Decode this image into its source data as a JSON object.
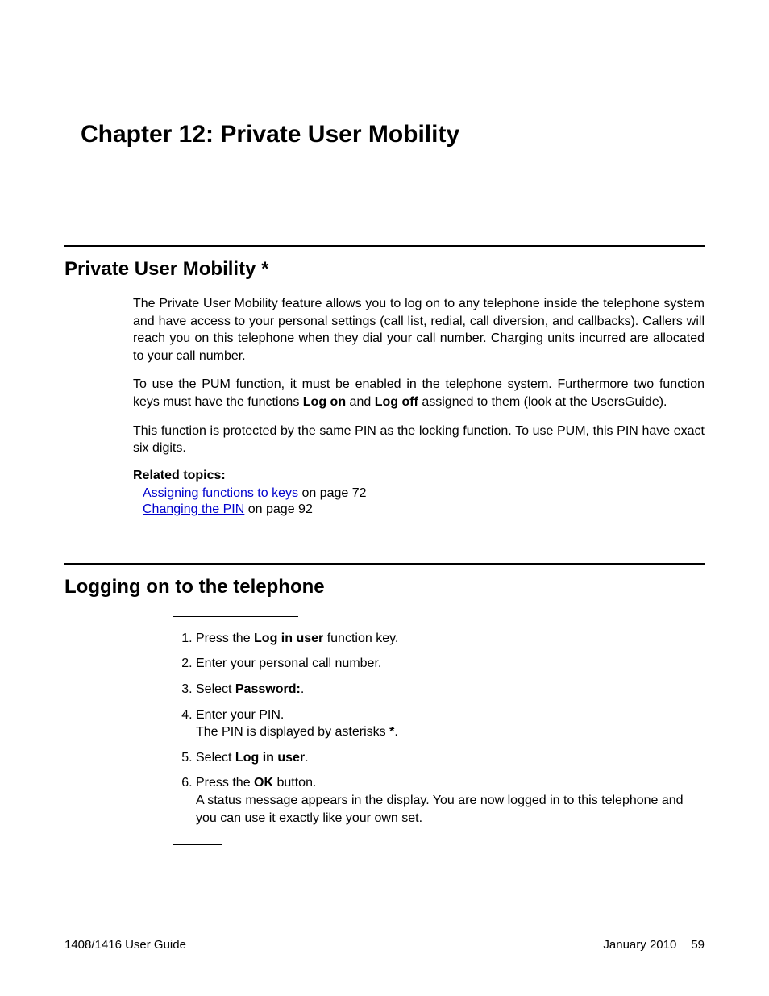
{
  "chapter": {
    "label": "Chapter 12:",
    "title": "Private User Mobility"
  },
  "section1": {
    "heading": "Private User Mobility *",
    "para1": "The Private User Mobility feature allows you to log on to any telephone inside the telephone system and have access to your personal settings (call list, redial, call diversion, and callbacks). Callers will reach you on this telephone when they dial your call number. Charging units incurred are allocated to your call number.",
    "para2a": "To use the PUM function, it must be enabled in the telephone system. Furthermore two function keys must have the functions ",
    "para2_bold1": "Log on",
    "para2b": " and ",
    "para2_bold2": "Log off",
    "para2c": " assigned to them (look at the UsersGuide).",
    "para3": "This function is protected by the same PIN as the locking function. To use PUM, this PIN have exact six digits.",
    "related_heading": "Related topics:",
    "related": [
      {
        "link": "Assigning functions to keys",
        "rest": " on page 72"
      },
      {
        "link": "Changing the PIN",
        "rest": " on page 92"
      }
    ]
  },
  "section2": {
    "heading": "Logging on to the telephone",
    "steps": {
      "s1a": "Press the ",
      "s1b": "Log in user",
      "s1c": " function key.",
      "s2": "Enter your personal call number.",
      "s3a": "Select ",
      "s3b": "Password:",
      "s3c": ".",
      "s4a": "Enter your PIN.",
      "s4b_a": "The PIN is displayed by asterisks ",
      "s4b_b": "*",
      "s4b_c": ".",
      "s5a": "Select ",
      "s5b": "Log in user",
      "s5c": ".",
      "s6a": "Press the ",
      "s6b": "OK",
      "s6c": " button.",
      "s6d": "A status message appears in the display. You are now logged in to this telephone and you can use it exactly like your own set."
    }
  },
  "footer": {
    "left": "1408/1416 User Guide",
    "date": "January 2010",
    "page": "59"
  }
}
